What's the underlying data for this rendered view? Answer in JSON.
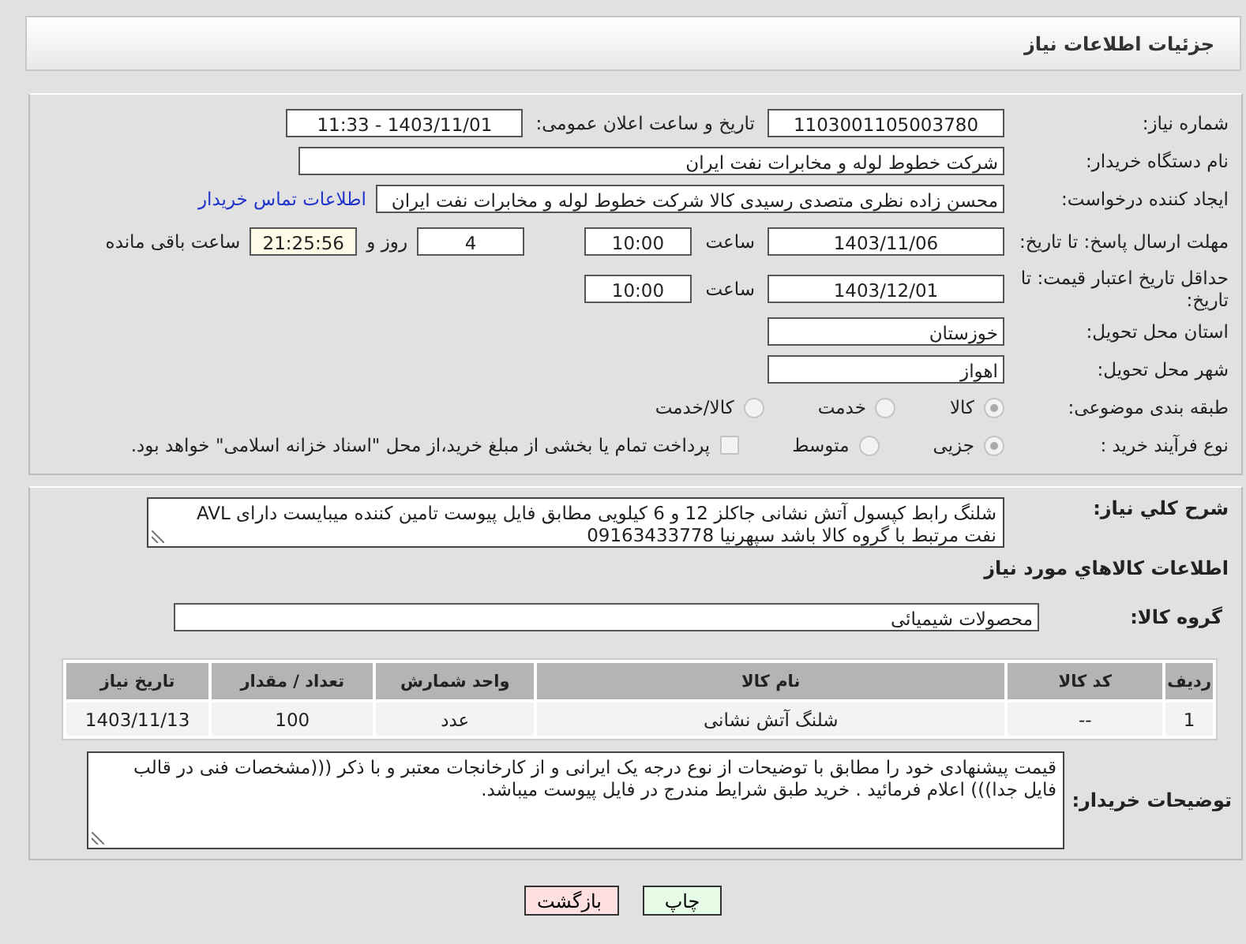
{
  "header": {
    "title": "جزئیات اطلاعات نیاز"
  },
  "need_number": {
    "label": "شماره نیاز:",
    "value": "1103001105003780"
  },
  "announce": {
    "label": "تاریخ و ساعت اعلان عمومی:",
    "value": "1403/11/01 - 11:33"
  },
  "buyer": {
    "label": "نام دستگاه خریدار:",
    "value": "شرکت خطوط لوله و مخابرات نفت ایران"
  },
  "requester": {
    "label": "ایجاد کننده درخواست:",
    "value": "محسن زاده نظری متصدی رسیدی کالا شرکت خطوط لوله و مخابرات نفت ایران",
    "link": "اطلاعات تماس خریدار"
  },
  "reply_deadline": {
    "label": "مهلت ارسال پاسخ: تا تاریخ:",
    "date": "1403/11/06",
    "time_label": "ساعت",
    "time": "10:00",
    "days": "4",
    "days_label": "روز و",
    "remaining": "21:25:56",
    "remaining_label": "ساعت باقی مانده"
  },
  "price_validity": {
    "label": "حداقل تاریخ اعتبار قیمت: تا تاریخ:",
    "date": "1403/12/01",
    "time_label": "ساعت",
    "time": "10:00"
  },
  "province": {
    "label": "استان محل تحویل:",
    "value": "خوزستان"
  },
  "city": {
    "label": "شهر محل تحویل:",
    "value": "اهواز"
  },
  "category": {
    "label": "طبقه بندی موضوعی:",
    "options": [
      {
        "label": "کالا",
        "selected": true
      },
      {
        "label": "خدمت",
        "selected": false
      },
      {
        "label": "کالا/خدمت",
        "selected": false
      }
    ]
  },
  "process": {
    "label": "نوع فرآیند خرید :",
    "options": [
      {
        "label": "جزیی",
        "selected": true
      },
      {
        "label": "متوسط",
        "selected": false
      }
    ],
    "payment": {
      "checked": false,
      "text": "پرداخت تمام یا بخشی از مبلغ خرید،از محل \"اسناد خزانه اسلامی\" خواهد بود."
    }
  },
  "description": {
    "label": "شرح کلي نیاز:",
    "text": "شلنگ رابط کپسول آتش نشانی جاکلز 12 و 6 کیلویی مطابق فایل پیوست تامین کننده میبایست دارای AVL نفت مرتبط با گروه کالا باشد سپهرنیا 09163433778"
  },
  "goods_title": "اطلاعات کالاهاي مورد نیاز",
  "goods_group": {
    "label": "گروه کالا:",
    "value": "محصولات شیمیائی"
  },
  "table": {
    "columns": [
      "ردیف",
      "کد کالا",
      "نام کالا",
      "واحد شمارش",
      "تعداد / مقدار",
      "تاریخ نیاز"
    ],
    "rows": [
      [
        "1",
        "--",
        "شلنگ آتش نشانی",
        "عدد",
        "100",
        "1403/11/13"
      ]
    ]
  },
  "buyer_notes": {
    "label": "توضیحات خریدار:",
    "text": "قیمت پیشنهادی خود را مطابق با توضیحات از نوع درجه یک ایرانی و از کارخانجات معتبر و با ذکر (((مشخصات فنی در قالب فایل جدا))) اعلام فرمائید . خرید طبق شرایط مندرج در فایل پیوست میباشد."
  },
  "buttons": [
    {
      "label": "چاپ",
      "kind": "print"
    },
    {
      "label": "بازگشت",
      "kind": "back"
    }
  ]
}
